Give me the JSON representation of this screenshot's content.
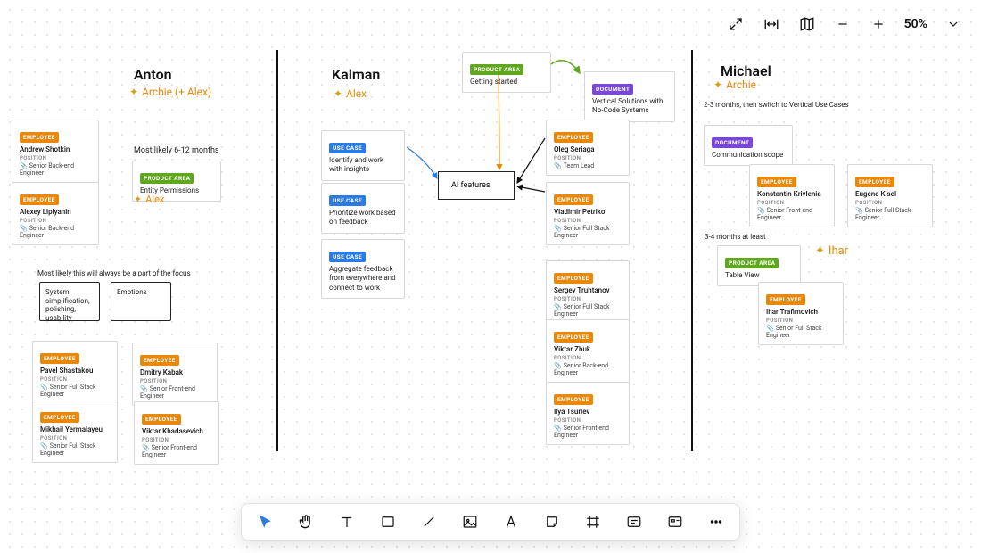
{
  "toolbar": {
    "zoom": "50%"
  },
  "columns": {
    "anton": {
      "title": "Anton",
      "subtitle": "Archie (+ Alex)"
    },
    "kalman": {
      "title": "Kalman",
      "subtitle": "Alex"
    },
    "michael": {
      "title": "Michael",
      "subtitle": "Archie"
    }
  },
  "notes": {
    "anton_timeline": "Most likely 6-12 months",
    "anton_focus": "Most likely this will always be a part of the focus",
    "note1": "System simplification, polishing, usability",
    "note2": "Emotions",
    "michael_timeline": "2-3 months, then switch to Vertical Use Cases",
    "michael_timeline2": "3-4 months at least",
    "ihar_label": "Ihar"
  },
  "tags": {
    "employee": "EMPLOYEE",
    "product_area": "PRODUCT AREA",
    "use_case": "USE CASE",
    "document": "DOCUMENT",
    "position": "POSITION"
  },
  "roles": {
    "sbe": "Senior Back-end Engineer",
    "sfs": "Senior Full Stack Engineer",
    "sfe": "Senior Front-end Engineer",
    "tl": "Team Lead"
  },
  "people": {
    "andrew": {
      "name": "Andrew Shotkin"
    },
    "alexey": {
      "name": "Alexey Liplyanin"
    },
    "pavel": {
      "name": "Pavel Shastakou"
    },
    "dmitry": {
      "name": "Dmitry Kabak"
    },
    "mikhail": {
      "name": "Mikhail Yermalayeu"
    },
    "viktar": {
      "name": "Viktar Khadasevich"
    },
    "oleg": {
      "name": "Oleg Seriaga"
    },
    "vladimir": {
      "name": "Vladimir Petriko"
    },
    "sergey": {
      "name": "Sergey Truhtanov"
    },
    "zhuk": {
      "name": "Viktar Zhuk"
    },
    "ilya": {
      "name": "Ilya Tsurlev"
    },
    "konstantin": {
      "name": "Konstantin Krivlenia"
    },
    "eugene": {
      "name": "Eugene Kisel"
    },
    "iharT": {
      "name": "Ihar Trafimovich"
    }
  },
  "blocks": {
    "entity_permissions": "Entity Permissions",
    "alex_under": "Alex",
    "getting_started": "Getting started",
    "pa_tag": "PRODUCT AREA",
    "vertical_doc": "Vertical Solutions with No-Code Systems",
    "uc1": "Identify and work with insights",
    "uc2": "Prioritize work based on feedback",
    "uc3": "Aggregate feedback from everywhere and connect to work",
    "ai": "AI features",
    "comm_scope": "Communication scope",
    "table_view": "Table View"
  }
}
